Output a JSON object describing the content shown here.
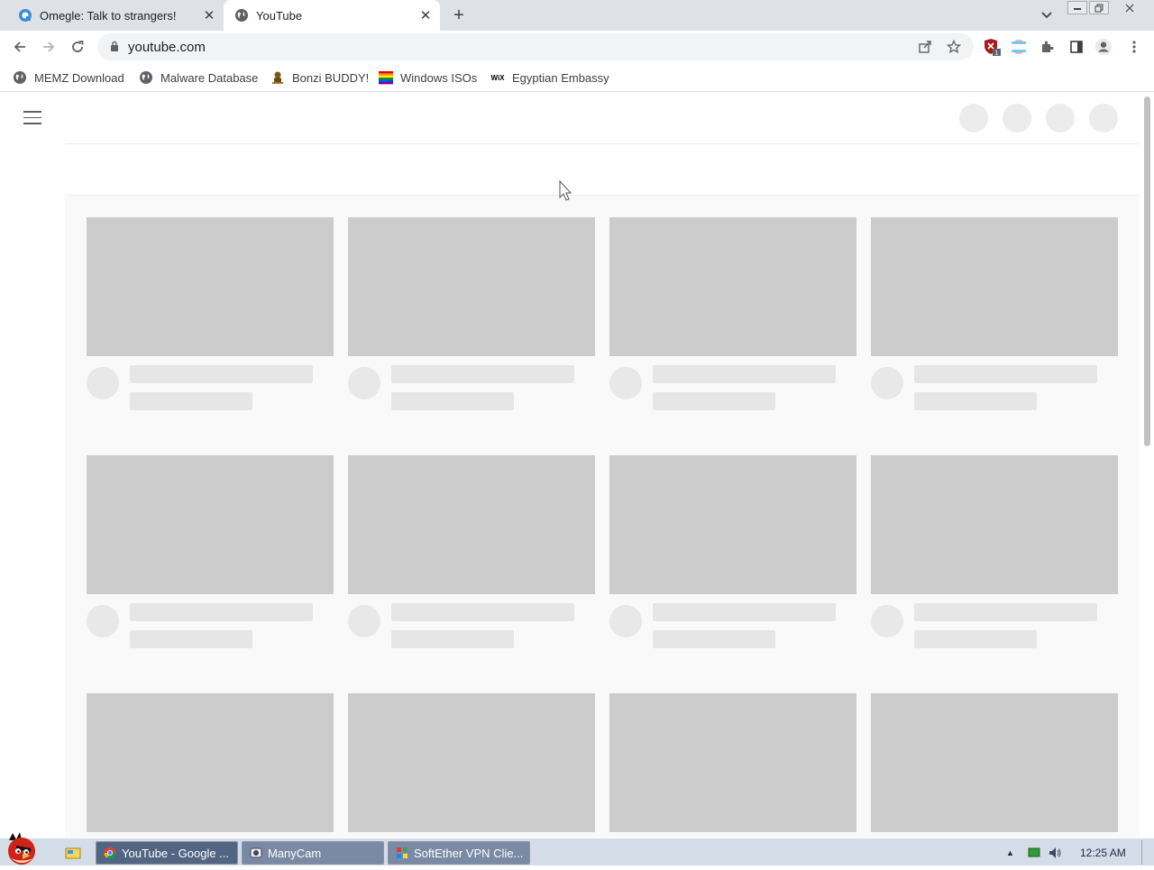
{
  "browser": {
    "tabs": [
      {
        "title": "Omegle: Talk to strangers!",
        "favicon": "omegle-icon",
        "active": false
      },
      {
        "title": "YouTube",
        "favicon": "globe-icon",
        "active": true
      }
    ],
    "new_tab_label": "+",
    "close_glyph": "✕",
    "url": "youtube.com",
    "bookmarks": [
      {
        "label": "MEMZ Download",
        "icon": "globe-icon"
      },
      {
        "label": "Malware Database",
        "icon": "globe-icon"
      },
      {
        "label": "Bonzi BUDDY!",
        "icon": "bonzi-icon"
      },
      {
        "label": "Windows ISOs",
        "icon": "rainbow-flag-icon"
      },
      {
        "label": "Egyptian Embassy",
        "icon": "wix-icon"
      }
    ],
    "extension_badge": "1",
    "wix_glyph": "WiX"
  },
  "page": {
    "loading_skeleton": true,
    "thumbnail_color": "#cccccc",
    "background_color": "#f9f9f9"
  },
  "taskbar": {
    "buttons": [
      {
        "label": "YouTube - Google ...",
        "icon": "chrome-icon"
      },
      {
        "label": "ManyCam",
        "icon": "manycam-icon"
      },
      {
        "label": "SoftEther VPN Clie...",
        "icon": "softether-icon"
      }
    ],
    "tray_expand": "▲",
    "clock": "12:25 AM"
  }
}
